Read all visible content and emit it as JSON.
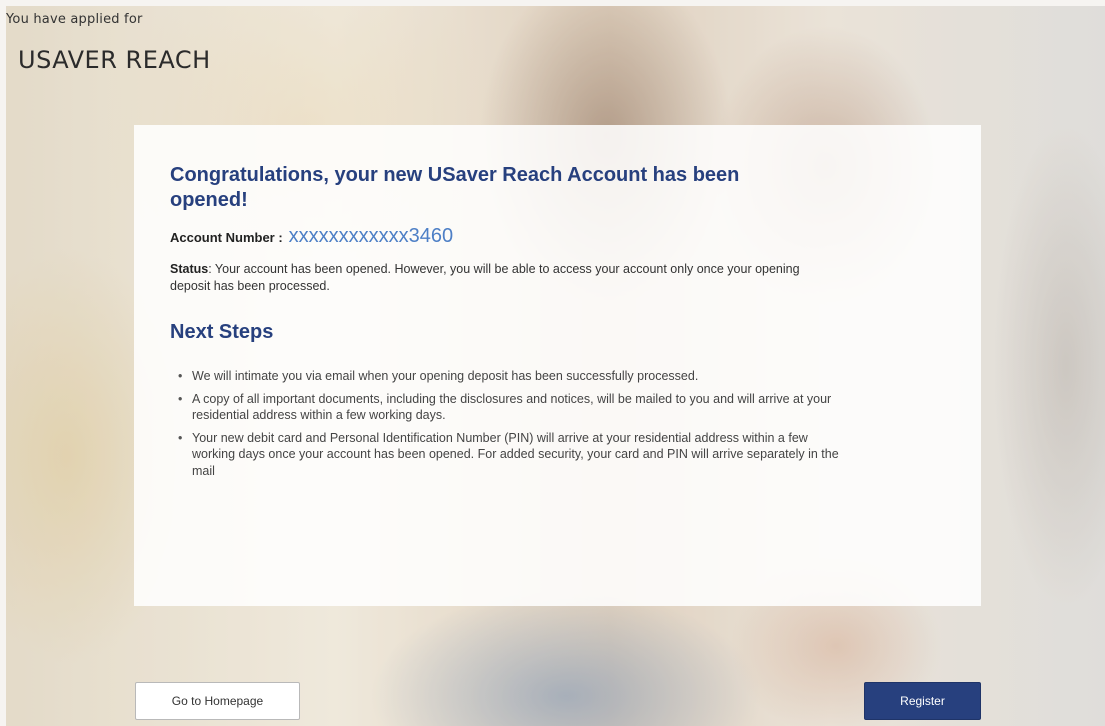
{
  "header": {
    "applied_label": "You have applied for",
    "product_title": "USAVER REACH"
  },
  "card": {
    "headline": "Congratulations, your new USaver Reach Account has been opened!",
    "account_label": "Account Number :",
    "account_value": "xxxxxxxxxxxx3460",
    "status_label": "Status",
    "status_text": ": Your account has been opened. However, you will be able to access your account only once your opening deposit has been processed.",
    "next_steps_title": "Next Steps",
    "next_steps": [
      "We will intimate you via email when your opening deposit has been successfully processed.",
      "A copy of all important documents, including the disclosures and notices, will be mailed to you and will arrive at your residential address within a few working days.",
      "Your new debit card and Personal Identification Number (PIN) will arrive at your residential address within a few working days once your account has been opened. For added security, your card and PIN will arrive separately in the mail"
    ],
    "bullet_glyph": "•"
  },
  "actions": {
    "home_label": "Go to Homepage",
    "register_label": "Register"
  },
  "colors": {
    "heading": "#27407e",
    "account_number": "#4d7fc6",
    "primary_button": "#27407e"
  }
}
